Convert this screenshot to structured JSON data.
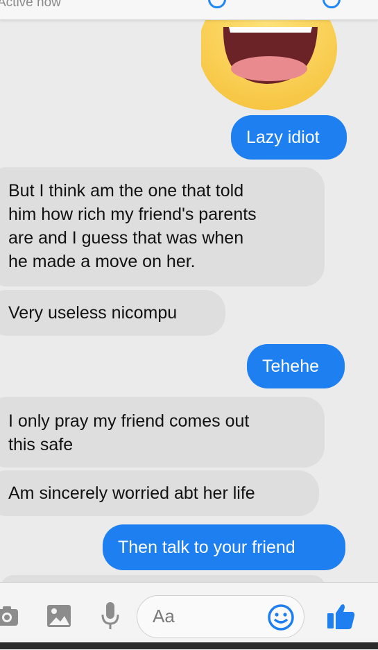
{
  "header": {
    "status": "Active now"
  },
  "messages": [
    {
      "side": "out",
      "text": "Lazy idiot"
    },
    {
      "side": "in",
      "text": "But I think am the one that told\nhim how rich my friend's parents\nare and I guess that was when\nhe made a move on her."
    },
    {
      "side": "in",
      "text": "Very useless nicompu"
    },
    {
      "side": "out",
      "text": "Tehehe"
    },
    {
      "side": "in",
      "text": "I only pray my friend comes out\nthis safe"
    },
    {
      "side": "in",
      "text": "Am sincerely worried abt her life"
    },
    {
      "side": "out",
      "text": "Then talk to your friend"
    }
  ],
  "composer": {
    "placeholder": "Aa",
    "icons": [
      "camera-icon",
      "image-icon",
      "microphone-icon",
      "emoji-icon",
      "thumbs-up-icon"
    ]
  },
  "colors": {
    "accent": "#1d7ff0",
    "incoming_bubble": "#dedede",
    "background": "#ebebeb"
  }
}
